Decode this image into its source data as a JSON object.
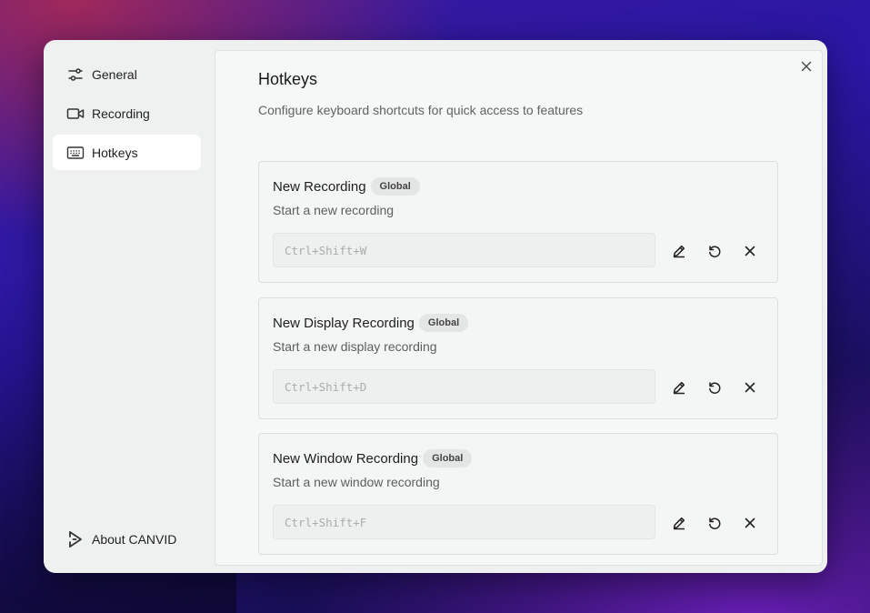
{
  "sidebar": {
    "items": [
      {
        "label": "General",
        "icon": "sliders-icon"
      },
      {
        "label": "Recording",
        "icon": "video-camera-icon"
      },
      {
        "label": "Hotkeys",
        "icon": "keyboard-icon",
        "active": true
      }
    ],
    "about_label": "About CANVID"
  },
  "page": {
    "title": "Hotkeys",
    "subtitle": "Configure keyboard shortcuts for quick access to features"
  },
  "hotkeys": [
    {
      "title": "New Recording",
      "badge": "Global",
      "description": "Start a new recording",
      "placeholder": "Ctrl+Shift+W"
    },
    {
      "title": "New Display Recording",
      "badge": "Global",
      "description": "Start a new display recording",
      "placeholder": "Ctrl+Shift+D"
    },
    {
      "title": "New Window Recording",
      "badge": "Global",
      "description": "Start a new window recording",
      "placeholder": "Ctrl+Shift+F"
    }
  ],
  "colors": {
    "window_bg": "#eff1f1",
    "active_item_bg": "#ffffff",
    "badge_bg": "#e4e6e6"
  }
}
